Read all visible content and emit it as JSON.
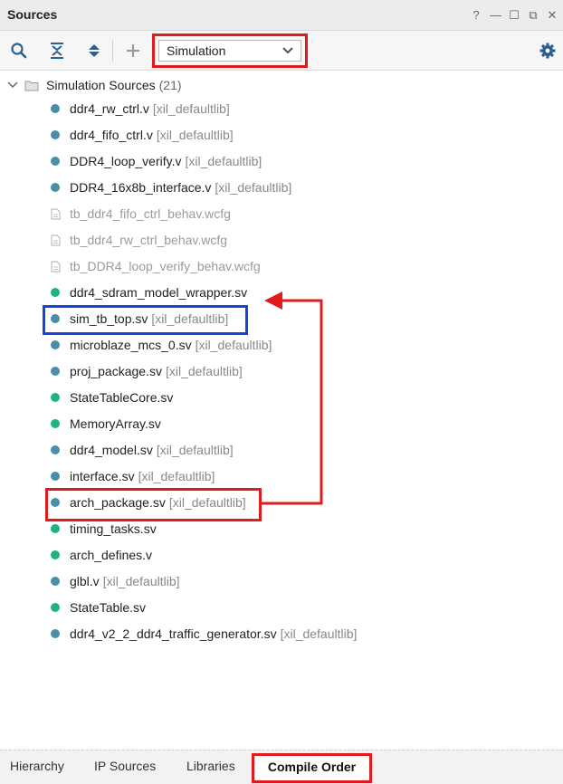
{
  "panel": {
    "title": "Sources"
  },
  "window_controls": [
    "?",
    "—",
    "☐",
    "⧉",
    "✕"
  ],
  "toolbar": {
    "icons": [
      "search-icon",
      "collapse-all-icon",
      "expand-all-icon",
      "add-icon",
      "gear-icon"
    ],
    "view_select": {
      "value": "Simulation"
    }
  },
  "tree": {
    "root": {
      "label": "Simulation Sources",
      "count": "(21)"
    },
    "items": [
      {
        "name": "ddr4_rw_ctrl.v",
        "lib": "[xil_defaultlib]",
        "icon": "blue"
      },
      {
        "name": "ddr4_fifo_ctrl.v",
        "lib": "[xil_defaultlib]",
        "icon": "blue"
      },
      {
        "name": "DDR4_loop_verify.v",
        "lib": "[xil_defaultlib]",
        "icon": "blue"
      },
      {
        "name": "DDR4_16x8b_interface.v",
        "lib": "[xil_defaultlib]",
        "icon": "blue"
      },
      {
        "name": "tb_ddr4_fifo_ctrl_behav.wcfg",
        "lib": "",
        "icon": "file"
      },
      {
        "name": "tb_ddr4_rw_ctrl_behav.wcfg",
        "lib": "",
        "icon": "file"
      },
      {
        "name": "tb_DDR4_loop_verify_behav.wcfg",
        "lib": "",
        "icon": "file"
      },
      {
        "name": "ddr4_sdram_model_wrapper.sv",
        "lib": "",
        "icon": "green"
      },
      {
        "name": "sim_tb_top.sv",
        "lib": "[xil_defaultlib]",
        "icon": "blue"
      },
      {
        "name": "microblaze_mcs_0.sv",
        "lib": "[xil_defaultlib]",
        "icon": "blue"
      },
      {
        "name": "proj_package.sv",
        "lib": "[xil_defaultlib]",
        "icon": "blue"
      },
      {
        "name": "StateTableCore.sv",
        "lib": "",
        "icon": "green"
      },
      {
        "name": "MemoryArray.sv",
        "lib": "",
        "icon": "green"
      },
      {
        "name": "ddr4_model.sv",
        "lib": "[xil_defaultlib]",
        "icon": "blue"
      },
      {
        "name": "interface.sv",
        "lib": "[xil_defaultlib]",
        "icon": "blue"
      },
      {
        "name": "arch_package.sv",
        "lib": "[xil_defaultlib]",
        "icon": "blue"
      },
      {
        "name": "timing_tasks.sv",
        "lib": "",
        "icon": "green"
      },
      {
        "name": "arch_defines.v",
        "lib": "",
        "icon": "green"
      },
      {
        "name": "glbl.v",
        "lib": "[xil_defaultlib]",
        "icon": "blue"
      },
      {
        "name": "StateTable.sv",
        "lib": "",
        "icon": "green"
      },
      {
        "name": "ddr4_v2_2_ddr4_traffic_generator.sv",
        "lib": "[xil_defaultlib]",
        "icon": "blue"
      }
    ]
  },
  "bottom_tabs": [
    "Hierarchy",
    "IP Sources",
    "Libraries",
    "Compile Order"
  ],
  "colors": {
    "highlight_red": "#e11b1b",
    "highlight_blue": "#1247d6",
    "dot_blue": "#4a8fa8",
    "dot_green": "#1fb57a"
  }
}
